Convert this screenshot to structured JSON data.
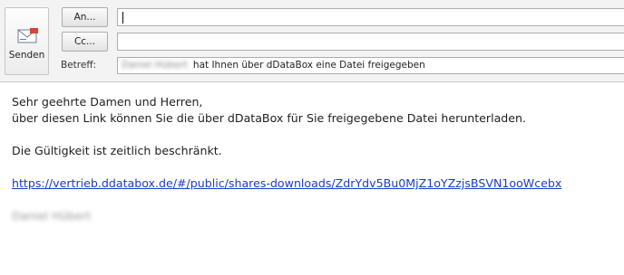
{
  "toolbar": {
    "send_label": "Senden"
  },
  "fields": {
    "to_button": "An...",
    "cc_button": "Cc...",
    "to_value": "",
    "cc_value": "",
    "subject_label": "Betreff:",
    "subject_sender_blurred": "Daniel Hübert",
    "subject_text": "hat Ihnen über dDataBox eine Datei freigegeben"
  },
  "body": {
    "greeting": "Sehr geehrte Damen und Herren,",
    "line1": "über diesen Link können Sie die über dDataBox für Sie freigegebene Datei herunterladen.",
    "validity": "Die Gültigkeit ist zeitlich beschränkt.",
    "link": "https://vertrieb.ddatabox.de/#/public/shares-downloads/ZdrYdv5Bu0MjZ1oYZzjsBSVN1ooWcebx",
    "signature_blurred": "Daniel Hübert"
  },
  "icons": {
    "send": "envelope-send-icon"
  }
}
